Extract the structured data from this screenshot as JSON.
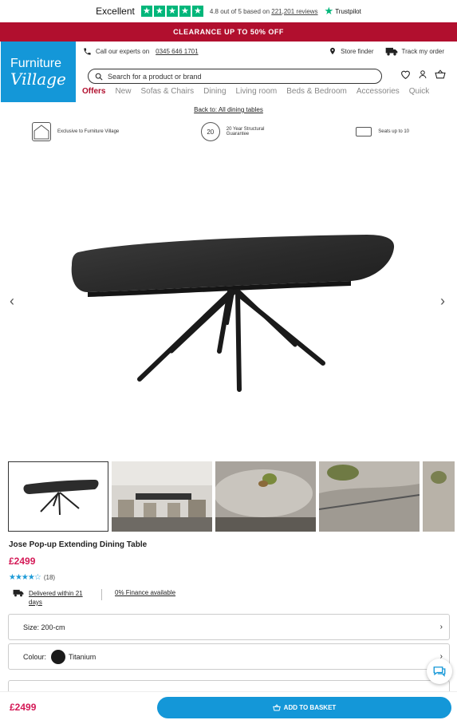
{
  "trustpilot": {
    "label": "Excellent",
    "rating_text": "4.8 out of 5 based on",
    "reviews_link": "221,201 reviews",
    "brand": "Trustpilot",
    "star_color": "#00b67a"
  },
  "banner": {
    "text": "CLEARANCE UP TO 50% OFF",
    "color": "#b10f2e"
  },
  "header": {
    "logo_line1": "Furniture",
    "logo_line2": "Village",
    "logo_color": "#1497d8",
    "call_text": "Call our experts on",
    "phone": "0345 646 1701",
    "store_finder": "Store finder",
    "track_order": "Track my order",
    "search_placeholder": "Search for a product or brand"
  },
  "nav": [
    "Offers",
    "New",
    "Sofas & Chairs",
    "Dining",
    "Living room",
    "Beds & Bedroom",
    "Accessories",
    "Quick"
  ],
  "breadcrumb": "Back to: All dining tables",
  "features": [
    {
      "icon": "furniture-village-house-icon",
      "text": "Exclusive to Furniture Village"
    },
    {
      "icon": "guarantee-20-icon",
      "badge": "20",
      "text": "20 Year Structural Guarantee"
    },
    {
      "icon": "table-seats-icon",
      "text": "Seats up to 10"
    }
  ],
  "product": {
    "name": "Jose Pop-up Extending Dining Table",
    "price": "£2499",
    "review_count": "(18)",
    "rating_stars": 4.5,
    "delivery": "Delivered within 21 days",
    "finance": "0% Finance available",
    "size_label": "Size: 200-cm",
    "colour_label": "Colour:",
    "colour_value": "Titanium",
    "colour_swatch": "#1b1b1b",
    "price_color": "#d41a57"
  },
  "sticky": {
    "price": "£2499",
    "button": "ADD TO BASKET"
  }
}
